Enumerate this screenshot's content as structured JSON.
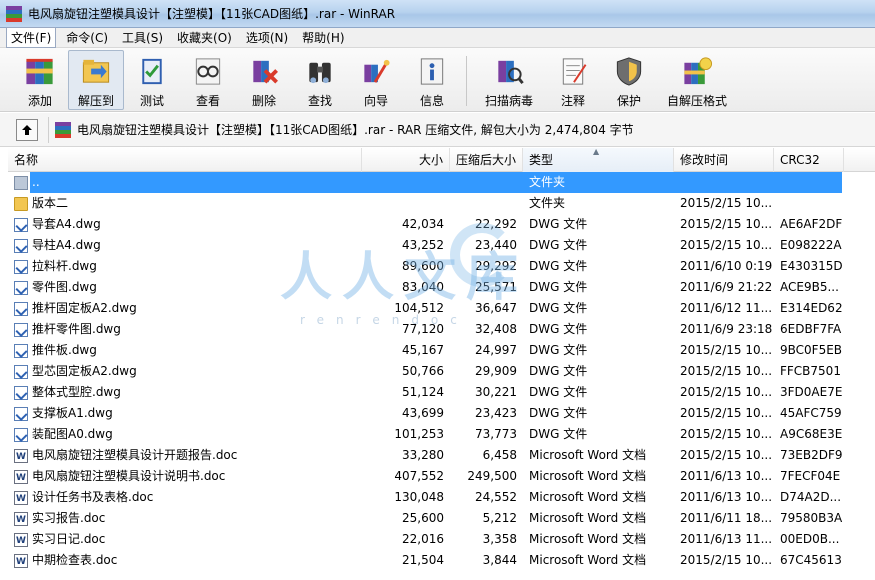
{
  "window": {
    "title": "电风扇旋钮注塑模具设计【注塑模】【11张CAD图纸】.rar - WinRAR"
  },
  "menu": [
    {
      "label": "文件(F)"
    },
    {
      "label": "命令(C)"
    },
    {
      "label": "工具(S)"
    },
    {
      "label": "收藏夹(O)"
    },
    {
      "label": "选项(N)"
    },
    {
      "label": "帮助(H)"
    }
  ],
  "toolbar": {
    "buttons": [
      {
        "label": "添加",
        "icon": "add-books-icon"
      },
      {
        "label": "解压到",
        "icon": "extract-folder-icon"
      },
      {
        "label": "测试",
        "icon": "test-book-icon"
      },
      {
        "label": "查看",
        "icon": "view-glasses-icon"
      },
      {
        "label": "删除",
        "icon": "delete-icon"
      },
      {
        "label": "查找",
        "icon": "find-binoculars-icon"
      },
      {
        "label": "向导",
        "icon": "wizard-icon"
      },
      {
        "label": "信息",
        "icon": "info-icon"
      },
      {
        "label": "扫描病毒",
        "icon": "virus-scan-icon"
      },
      {
        "label": "注释",
        "icon": "comment-icon"
      },
      {
        "label": "保护",
        "icon": "protect-shield-icon"
      },
      {
        "label": "自解压格式",
        "icon": "sfx-icon"
      }
    ]
  },
  "pathbar": {
    "text": "电风扇旋钮注塑模具设计【注塑模】【11张CAD图纸】.rar - RAR 压缩文件, 解包大小为 2,474,804 字节"
  },
  "columns": {
    "name": "名称",
    "size": "大小",
    "packed": "压缩后大小",
    "type": "类型",
    "modified": "修改时间",
    "crc": "CRC32"
  },
  "files": [
    {
      "name": "..",
      "size": "",
      "packed": "",
      "type": "文件夹",
      "modified": "",
      "crc": "",
      "kind": "up"
    },
    {
      "name": "版本二",
      "size": "",
      "packed": "",
      "type": "文件夹",
      "modified": "2015/2/15 10...",
      "crc": "",
      "kind": "folder"
    },
    {
      "name": "导套A4.dwg",
      "size": "42,034",
      "packed": "22,292",
      "type": "DWG 文件",
      "modified": "2015/2/15 10...",
      "crc": "AE6AF2DF",
      "kind": "dwg"
    },
    {
      "name": "导柱A4.dwg",
      "size": "43,252",
      "packed": "23,440",
      "type": "DWG 文件",
      "modified": "2015/2/15 10...",
      "crc": "E098222A",
      "kind": "dwg"
    },
    {
      "name": "拉料杆.dwg",
      "size": "89,600",
      "packed": "29,292",
      "type": "DWG 文件",
      "modified": "2011/6/10 0:19",
      "crc": "E430315D",
      "kind": "dwg"
    },
    {
      "name": "零件图.dwg",
      "size": "83,040",
      "packed": "25,571",
      "type": "DWG 文件",
      "modified": "2011/6/9 21:22",
      "crc": "ACE9B5...",
      "kind": "dwg"
    },
    {
      "name": "推杆固定板A2.dwg",
      "size": "104,512",
      "packed": "36,647",
      "type": "DWG 文件",
      "modified": "2011/6/12 11...",
      "crc": "E314ED62",
      "kind": "dwg"
    },
    {
      "name": "推杆零件图.dwg",
      "size": "77,120",
      "packed": "32,408",
      "type": "DWG 文件",
      "modified": "2011/6/9 23:18",
      "crc": "6EDBF7FA",
      "kind": "dwg"
    },
    {
      "name": "推件板.dwg",
      "size": "45,167",
      "packed": "24,997",
      "type": "DWG 文件",
      "modified": "2015/2/15 10...",
      "crc": "9BC0F5EB",
      "kind": "dwg"
    },
    {
      "name": "型芯固定板A2.dwg",
      "size": "50,766",
      "packed": "29,909",
      "type": "DWG 文件",
      "modified": "2015/2/15 10...",
      "crc": "FFCB7501",
      "kind": "dwg"
    },
    {
      "name": "整体式型腔.dwg",
      "size": "51,124",
      "packed": "30,221",
      "type": "DWG 文件",
      "modified": "2015/2/15 10...",
      "crc": "3FD0AE7E",
      "kind": "dwg"
    },
    {
      "name": "支撑板A1.dwg",
      "size": "43,699",
      "packed": "23,423",
      "type": "DWG 文件",
      "modified": "2015/2/15 10...",
      "crc": "45AFC759",
      "kind": "dwg"
    },
    {
      "name": "装配图A0.dwg",
      "size": "101,253",
      "packed": "73,773",
      "type": "DWG 文件",
      "modified": "2015/2/15 10...",
      "crc": "A9C68E3E",
      "kind": "dwg"
    },
    {
      "name": "电风扇旋钮注塑模具设计开题报告.doc",
      "size": "33,280",
      "packed": "6,458",
      "type": "Microsoft Word 文档",
      "modified": "2015/2/15 10...",
      "crc": "73EB2DF9",
      "kind": "doc"
    },
    {
      "name": "电风扇旋钮注塑模具设计说明书.doc",
      "size": "407,552",
      "packed": "249,500",
      "type": "Microsoft Word 文档",
      "modified": "2011/6/13 10...",
      "crc": "7FECF04E",
      "kind": "doc"
    },
    {
      "name": "设计任务书及表格.doc",
      "size": "130,048",
      "packed": "24,552",
      "type": "Microsoft Word 文档",
      "modified": "2011/6/13 10...",
      "crc": "D74A2D...",
      "kind": "doc"
    },
    {
      "name": "实习报告.doc",
      "size": "25,600",
      "packed": "5,212",
      "type": "Microsoft Word 文档",
      "modified": "2011/6/11 18...",
      "crc": "79580B3A",
      "kind": "doc"
    },
    {
      "name": "实习日记.doc",
      "size": "22,016",
      "packed": "3,358",
      "type": "Microsoft Word 文档",
      "modified": "2011/6/13 11...",
      "crc": "00ED0B...",
      "kind": "doc"
    },
    {
      "name": "中期检查表.doc",
      "size": "21,504",
      "packed": "3,844",
      "type": "Microsoft Word 文档",
      "modified": "2015/2/15 10...",
      "crc": "67C45613",
      "kind": "doc"
    }
  ],
  "watermark": {
    "text": "人人文库",
    "sub": "renrendoc"
  }
}
